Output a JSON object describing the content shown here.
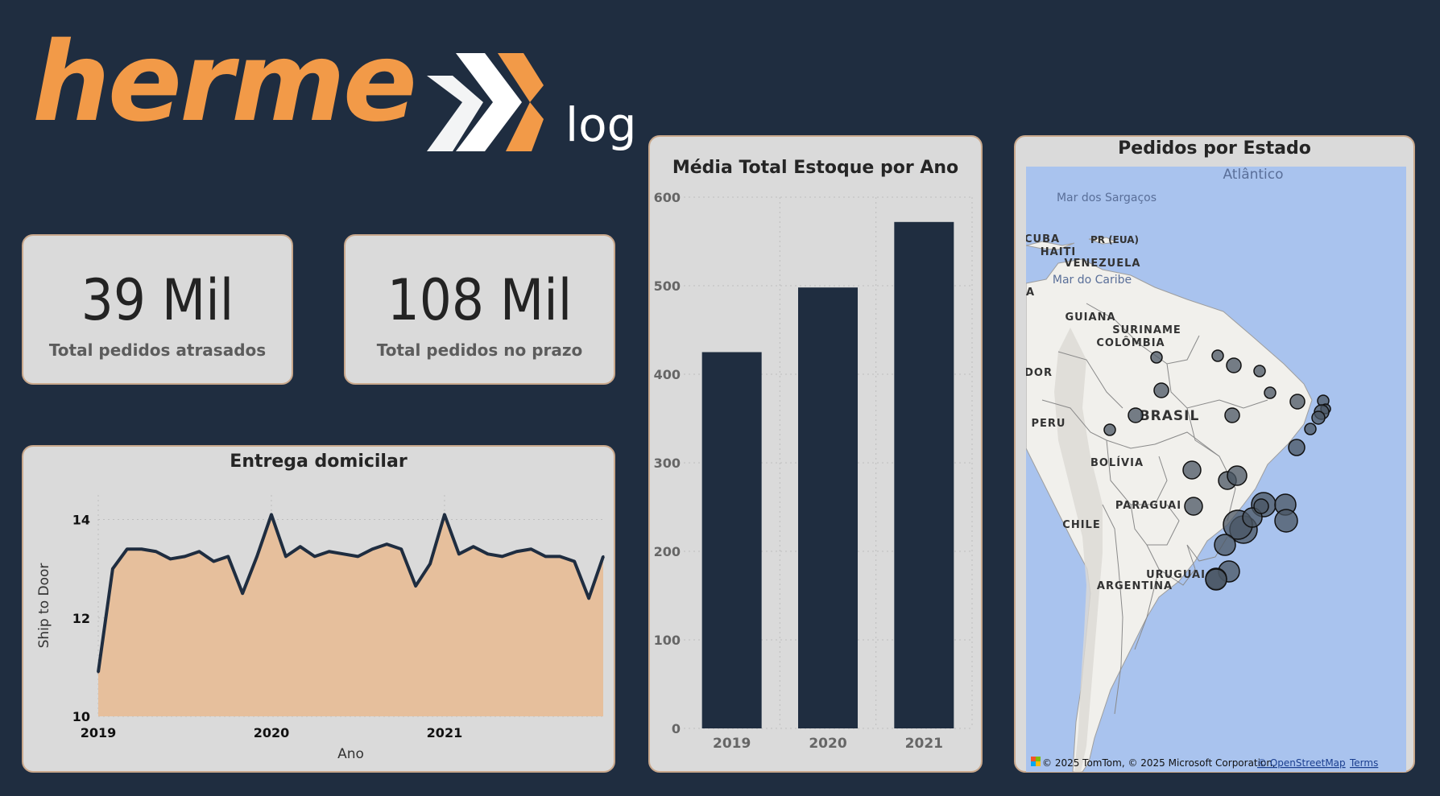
{
  "logo": {
    "wordmark": "herme",
    "suffix": "log",
    "colors": {
      "wordmark": "#f29a48",
      "mark": "#ffffff",
      "suffix": "#ffffff"
    }
  },
  "kpis": [
    {
      "value": "39 Mil",
      "label": "Total pedidos atrasados"
    },
    {
      "value": "108 Mil",
      "label": "Total pedidos no prazo"
    }
  ],
  "theme": {
    "background": "#1f2d40",
    "card": "#dadada",
    "card_border": "#c9a88c",
    "bar": "#1f2d40",
    "area_fill": "#e6bf9c",
    "line": "#1f2d40"
  },
  "chart_data": [
    {
      "type": "area",
      "title": "Entrega domicilar",
      "xlabel": "Ano",
      "ylabel": "Ship to Door",
      "ylim": [
        10,
        14.5
      ],
      "yticks": [
        "10",
        "12",
        "14"
      ],
      "xticks": [
        {
          "label": "2019",
          "month": 0
        },
        {
          "label": "2020",
          "month": 12
        },
        {
          "label": "2021",
          "month": 24
        }
      ],
      "grid": true,
      "x_months": [
        0,
        1,
        2,
        3,
        4,
        5,
        6,
        7,
        8,
        9,
        10,
        11,
        12,
        13,
        14,
        15,
        16,
        17,
        18,
        19,
        20,
        21,
        22,
        23,
        24,
        25,
        26,
        27,
        28,
        29,
        30,
        31,
        32,
        33,
        34,
        35
      ],
      "values": [
        10.9,
        13.0,
        13.4,
        13.4,
        13.35,
        13.2,
        13.25,
        13.35,
        13.15,
        13.25,
        12.5,
        13.25,
        14.1,
        13.25,
        13.45,
        13.25,
        13.35,
        13.3,
        13.25,
        13.4,
        13.5,
        13.4,
        12.65,
        13.1,
        14.1,
        13.3,
        13.45,
        13.3,
        13.25,
        13.35,
        13.4,
        13.25,
        13.25,
        13.15,
        12.4,
        13.25
      ]
    },
    {
      "type": "bar",
      "title": "Média Total Estoque por Ano",
      "categories": [
        "2019",
        "2020",
        "2021"
      ],
      "values": [
        425,
        498,
        572
      ],
      "ylim": [
        0,
        600
      ],
      "yticks": [
        "0",
        "100",
        "200",
        "300",
        "400",
        "500",
        "600"
      ],
      "grid": true
    }
  ],
  "map": {
    "title": "Pedidos por Estado",
    "ocean_labels": [
      "Atlântico",
      "Mar dos Sargaços",
      "Mar do Caribe"
    ],
    "country_labels": [
      "CUBA",
      "HAITI",
      "PR (EUA)",
      "VENEZUELA",
      "GUIANA",
      "SURINAME",
      "COLÔMBIA",
      "ADOR",
      "PERU",
      "BRASIL",
      "BOLÍVIA",
      "PARAGUAI",
      "CHILE",
      "URUGUAI",
      "ARGENTINA",
      "UA"
    ],
    "attribution": "© 2025 TomTom, © 2025 Microsoft Corporation,",
    "attribution_link": "© OpenStreetMap",
    "terms_link": "Terms",
    "bubble_count": 31
  }
}
